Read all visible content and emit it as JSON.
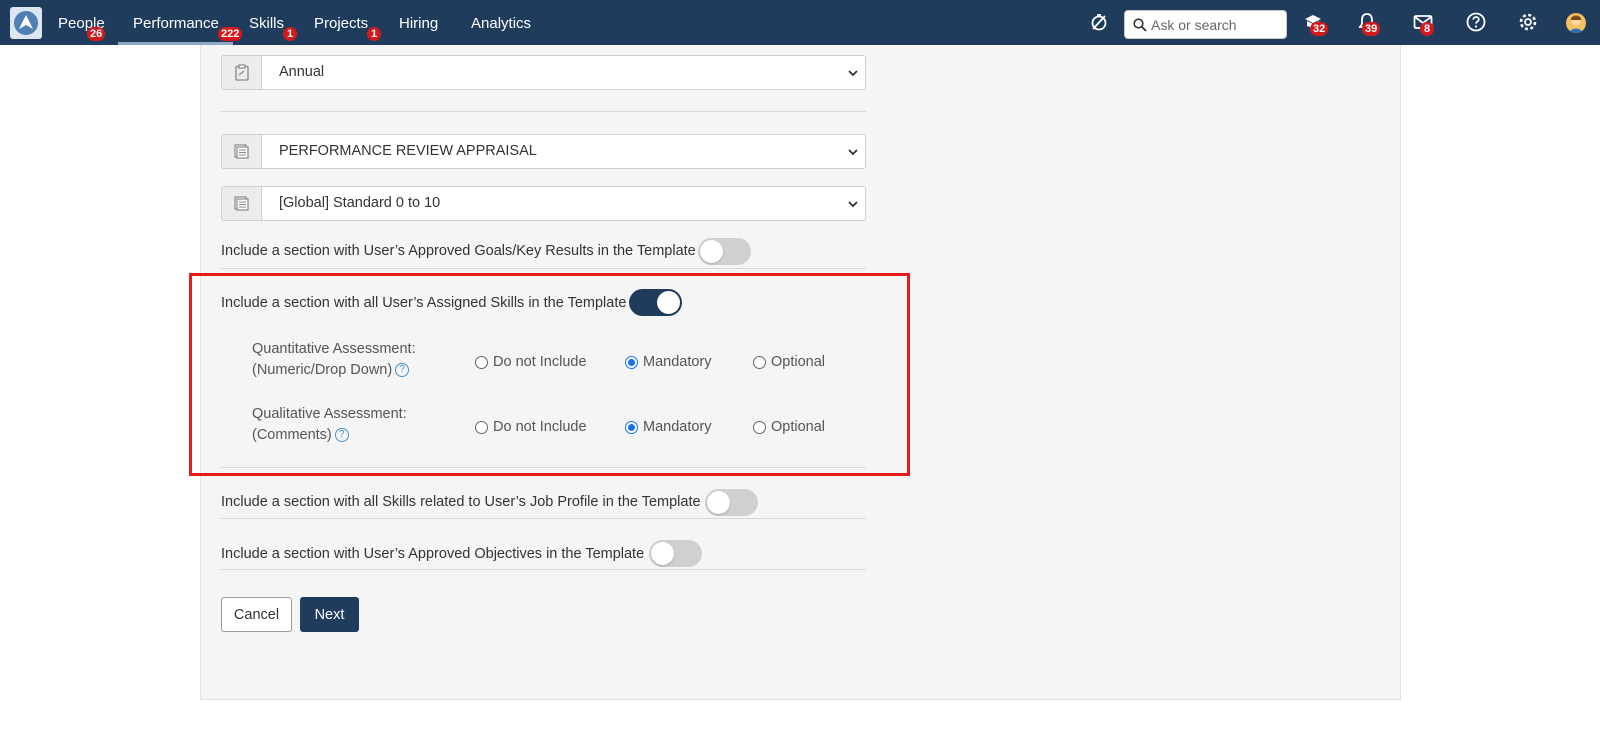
{
  "nav": {
    "items": [
      {
        "label": "People",
        "badge": "26"
      },
      {
        "label": "Performance",
        "badge": "222"
      },
      {
        "label": "Skills",
        "badge": "1"
      },
      {
        "label": "Projects",
        "badge": "1"
      },
      {
        "label": "Hiring",
        "badge": ""
      },
      {
        "label": "Analytics",
        "badge": ""
      }
    ],
    "active": "Performance",
    "search_placeholder": "Ask or search",
    "icons": {
      "timer": "no-timer-icon",
      "learning": {
        "name": "graduation-icon",
        "badge": "32"
      },
      "notifications": {
        "name": "bell-icon",
        "badge": "39"
      },
      "messages": {
        "name": "mail-icon",
        "badge": "8"
      },
      "help": "help-icon",
      "settings": "gear-icon"
    }
  },
  "form": {
    "frequency": "Annual",
    "template": "PERFORMANCE REVIEW APPRAISAL",
    "rating_scale": "[Global] Standard 0 to 10",
    "options": {
      "goals": {
        "label": "Include a section with User’s Approved Goals/Key Results in the Template",
        "enabled": false
      },
      "assigned_skills": {
        "label": "Include a section with all User’s Assigned Skills in the Template",
        "enabled": true
      },
      "job_profile_skills": {
        "label": "Include a section with all Skills related to User’s Job Profile in the Template",
        "enabled": false
      },
      "objectives": {
        "label": "Include a section with User’s Approved Objectives in the Template",
        "enabled": false
      }
    },
    "assessments": {
      "quantitative": {
        "line1": "Quantitative Assessment:",
        "line2": "(Numeric/Drop Down)",
        "selected": "Mandatory"
      },
      "qualitative": {
        "line1": "Qualitative Assessment:",
        "line2": "(Comments)",
        "selected": "Mandatory"
      }
    },
    "radio_labels": {
      "not_include": "Do not Include",
      "mandatory": "Mandatory",
      "optional": "Optional"
    },
    "buttons": {
      "cancel": "Cancel",
      "next": "Next"
    }
  },
  "colors": {
    "navbar": "#203c5d",
    "highlight": "#e81b1b",
    "badge": "#d5181b",
    "toggle_on": "#203c5d"
  }
}
